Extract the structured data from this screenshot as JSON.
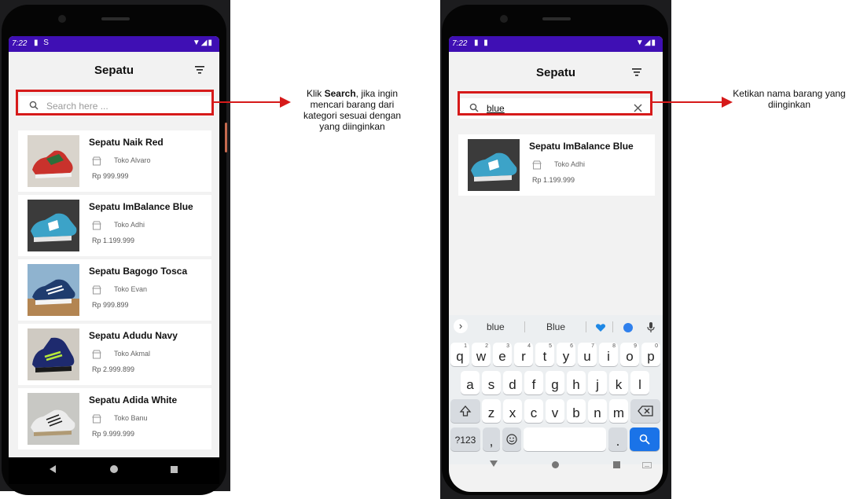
{
  "left_phone": {
    "status": {
      "time": "7:22",
      "left_icons": "▮ S",
      "right_icons": "▼◢▮"
    },
    "app_title": "Sepatu",
    "search": {
      "placeholder": "Search here ..."
    },
    "products": [
      {
        "name": "Sepatu Naik Red",
        "store": "Toko Alvaro",
        "price": "Rp 999.999",
        "image": "red-sneaker"
      },
      {
        "name": "Sepatu ImBalance Blue",
        "store": "Toko Adhi",
        "price": "Rp 1.199.999",
        "image": "blue-sneaker"
      },
      {
        "name": "Sepatu Bagogo Tosca",
        "store": "Toko Evan",
        "price": "Rp 999.899",
        "image": "navy-white-sneaker"
      },
      {
        "name": "Sepatu Adudu Navy",
        "store": "Toko Akmal",
        "price": "Rp 2.999.899",
        "image": "navy-lime-sneaker"
      },
      {
        "name": "Sepatu Adida White",
        "store": "Toko Banu",
        "price": "Rp 9.999.999",
        "image": "white-sneaker"
      }
    ]
  },
  "right_phone": {
    "status": {
      "time": "7:22",
      "left_icons": "▮ ▮",
      "right_icons": "▼◢▮"
    },
    "app_title": "Sepatu",
    "search": {
      "value": "blue"
    },
    "products": [
      {
        "name": "Sepatu ImBalance Blue",
        "store": "Toko Adhi",
        "price": "Rp 1.199.999",
        "image": "blue-sneaker"
      }
    ],
    "keyboard": {
      "suggestions": [
        "blue",
        "Blue"
      ],
      "row1": [
        [
          "q",
          "1"
        ],
        [
          "w",
          "2"
        ],
        [
          "e",
          "3"
        ],
        [
          "r",
          "4"
        ],
        [
          "t",
          "5"
        ],
        [
          "y",
          "6"
        ],
        [
          "u",
          "7"
        ],
        [
          "i",
          "8"
        ],
        [
          "o",
          "9"
        ],
        [
          "p",
          "0"
        ]
      ],
      "row2": [
        "a",
        "s",
        "d",
        "f",
        "g",
        "h",
        "j",
        "k",
        "l"
      ],
      "row3": [
        "z",
        "x",
        "c",
        "v",
        "b",
        "n",
        "m"
      ],
      "symbols_label": "?123",
      "comma_label": ",",
      "period_label": "."
    }
  },
  "annotations": {
    "left_prefix": "Klik ",
    "left_bold": "Search",
    "left_rest": ", jika ingin mencari barang dari kategori sesuai dengan yang diinginkan",
    "right": "Ketikan nama barang yang diinginkan"
  },
  "colors": {
    "status_bar": "#3f0fb4",
    "highlight": "#d61a1a",
    "keyboard_action": "#1a73e8"
  }
}
